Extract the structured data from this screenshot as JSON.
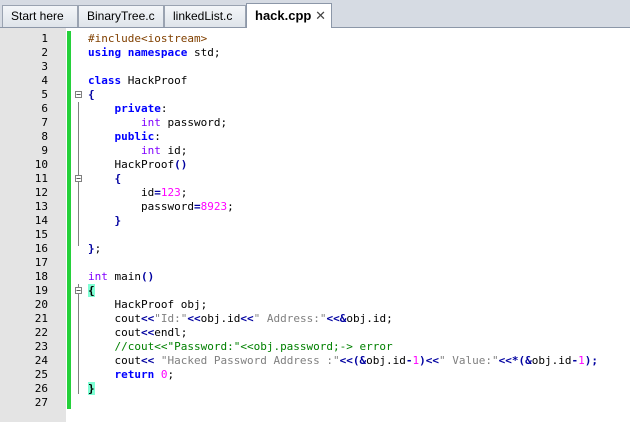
{
  "tabs": [
    {
      "label": "Start here",
      "active": false
    },
    {
      "label": "BinaryTree.c",
      "active": false
    },
    {
      "label": "linkedList.c",
      "active": false
    },
    {
      "label": "hack.cpp",
      "active": true
    }
  ],
  "close_glyph": "✕",
  "colors": {
    "change_bar": "#24d03a",
    "brace_highlight": "#7fffd4",
    "keyword": "#0000ff",
    "number": "#ff00ff",
    "string": "#808080",
    "comment": "#008000"
  },
  "lines": [
    {
      "n": "1",
      "tokens": [
        [
          "pp",
          "#include<iostream>"
        ]
      ]
    },
    {
      "n": "2",
      "tokens": [
        [
          "kw",
          "using"
        ],
        [
          "id",
          " "
        ],
        [
          "kw",
          "namespace"
        ],
        [
          "id",
          " std;"
        ]
      ]
    },
    {
      "n": "3",
      "tokens": []
    },
    {
      "n": "4",
      "tokens": [
        [
          "kw",
          "class"
        ],
        [
          "id",
          " HackProof"
        ]
      ]
    },
    {
      "n": "5",
      "tokens": [
        [
          "paren",
          "{"
        ]
      ],
      "fold": "−"
    },
    {
      "n": "6",
      "tokens": [
        [
          "id",
          "    "
        ],
        [
          "kw",
          "private"
        ],
        [
          "id",
          ":"
        ]
      ]
    },
    {
      "n": "7",
      "tokens": [
        [
          "id",
          "        "
        ],
        [
          "type",
          "int"
        ],
        [
          "id",
          " password;"
        ]
      ]
    },
    {
      "n": "8",
      "tokens": [
        [
          "id",
          "    "
        ],
        [
          "kw",
          "public"
        ],
        [
          "id",
          ":"
        ]
      ]
    },
    {
      "n": "9",
      "tokens": [
        [
          "id",
          "        "
        ],
        [
          "type",
          "int"
        ],
        [
          "id",
          " id;"
        ]
      ]
    },
    {
      "n": "10",
      "tokens": [
        [
          "id",
          "    HackProof"
        ],
        [
          "paren",
          "()"
        ]
      ]
    },
    {
      "n": "11",
      "tokens": [
        [
          "id",
          "    "
        ],
        [
          "paren",
          "{"
        ]
      ],
      "fold": "−"
    },
    {
      "n": "12",
      "tokens": [
        [
          "id",
          "        id"
        ],
        [
          "op",
          "="
        ],
        [
          "num",
          "123"
        ],
        [
          "id",
          ";"
        ]
      ]
    },
    {
      "n": "13",
      "tokens": [
        [
          "id",
          "        password"
        ],
        [
          "op",
          "="
        ],
        [
          "num",
          "8923"
        ],
        [
          "id",
          ";"
        ]
      ]
    },
    {
      "n": "14",
      "tokens": [
        [
          "id",
          "    "
        ],
        [
          "paren",
          "}"
        ]
      ]
    },
    {
      "n": "15",
      "tokens": []
    },
    {
      "n": "16",
      "tokens": [
        [
          "paren",
          "}"
        ],
        [
          "id",
          ";"
        ]
      ]
    },
    {
      "n": "17",
      "tokens": []
    },
    {
      "n": "18",
      "tokens": [
        [
          "type",
          "int"
        ],
        [
          "id",
          " main"
        ],
        [
          "paren",
          "()"
        ]
      ]
    },
    {
      "n": "19",
      "tokens": [
        [
          "parenhl",
          "{"
        ]
      ],
      "fold": "−"
    },
    {
      "n": "20",
      "tokens": [
        [
          "id",
          "    HackProof obj;"
        ]
      ]
    },
    {
      "n": "21",
      "tokens": [
        [
          "id",
          "    cout"
        ],
        [
          "op",
          "<<"
        ],
        [
          "str",
          "\"Id:\""
        ],
        [
          "op",
          "<<"
        ],
        [
          "id",
          "obj.id"
        ],
        [
          "op",
          "<<"
        ],
        [
          "str",
          "\" Address:\""
        ],
        [
          "op",
          "<<&"
        ],
        [
          "id",
          "obj.id;"
        ]
      ]
    },
    {
      "n": "22",
      "tokens": [
        [
          "id",
          "    cout"
        ],
        [
          "op",
          "<<"
        ],
        [
          "id",
          "endl;"
        ]
      ]
    },
    {
      "n": "23",
      "tokens": [
        [
          "id",
          "    "
        ],
        [
          "cmt",
          "//cout<<\"Password:\"<<obj.password;-> error"
        ]
      ]
    },
    {
      "n": "24",
      "tokens": [
        [
          "id",
          "    cout"
        ],
        [
          "op",
          "<<"
        ],
        [
          "id",
          " "
        ],
        [
          "str",
          "\"Hacked Password Address :\""
        ],
        [
          "op",
          "<<(&"
        ],
        [
          "id",
          "obj.id"
        ],
        [
          "op",
          "-"
        ],
        [
          "num",
          "1"
        ],
        [
          "op",
          ")<<"
        ],
        [
          "str",
          "\" Value:\""
        ],
        [
          "op",
          "<<*(&"
        ],
        [
          "id",
          "obj.id"
        ],
        [
          "op",
          "-"
        ],
        [
          "num",
          "1"
        ],
        [
          "op",
          ");"
        ]
      ]
    },
    {
      "n": "25",
      "tokens": [
        [
          "id",
          "    "
        ],
        [
          "kw",
          "return"
        ],
        [
          "id",
          " "
        ],
        [
          "num",
          "0"
        ],
        [
          "id",
          ";"
        ]
      ]
    },
    {
      "n": "26",
      "tokens": [
        [
          "parenhl",
          "}"
        ]
      ]
    },
    {
      "n": "27",
      "tokens": []
    }
  ]
}
